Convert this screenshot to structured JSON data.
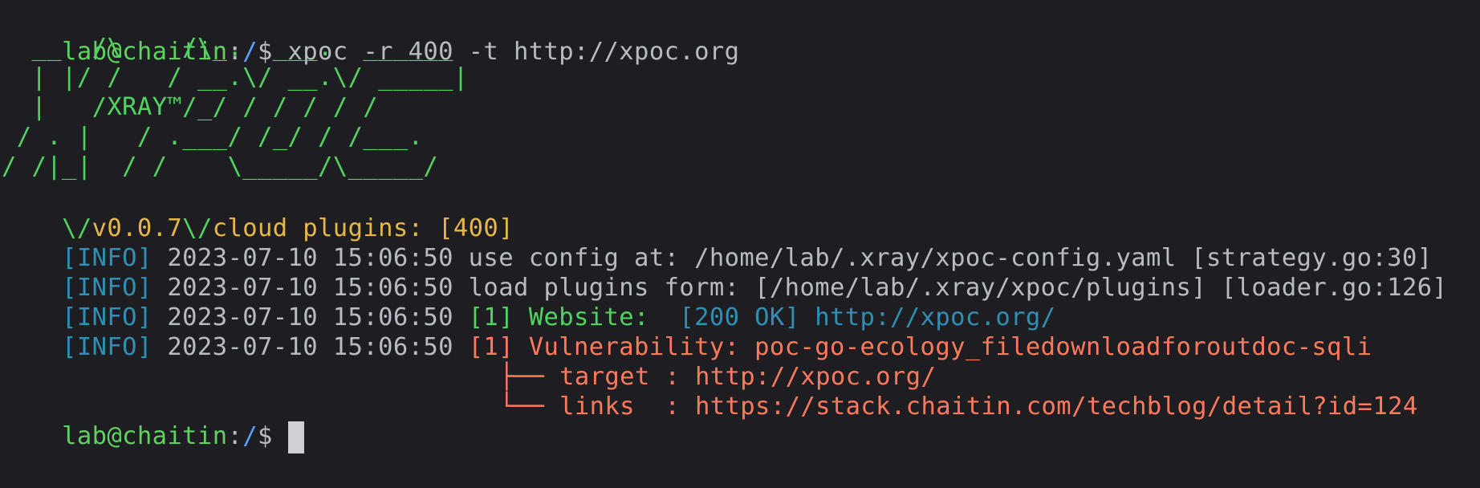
{
  "prompt": {
    "user_host": "lab@chaitin",
    "separator": ":",
    "path": "/",
    "symbol": "$ "
  },
  "command": "xpoc -r 400 -t http://xpoc.org",
  "banner": [
    "  __  /\\    /\\_.  ___.  ______",
    "  | |/ /   / __.\\/ __.\\/ _____|",
    "  |   /XRAY™/_/ / / / / /",
    " / . |   / .___/ /_/ / /___.",
    "/ /|_|  / /    \\_____/\\_____/"
  ],
  "version_line": {
    "prefix": "\\/",
    "version": "v0.0.7",
    "middle": "\\/",
    "channel": "cloud plugins: [400]"
  },
  "logs": [
    {
      "level": "[INFO]",
      "timestamp": "2023-07-10 15:06:50",
      "message": "use config at: /home/lab/.xray/xpoc-config.yaml [strategy.go:30]"
    },
    {
      "level": "[INFO]",
      "timestamp": "2023-07-10 15:06:50",
      "message": "load plugins form: [/home/lab/.xray/xpoc/plugins] [loader.go:126]"
    },
    {
      "level": "[INFO]",
      "timestamp": "2023-07-10 15:06:50",
      "tag": "[1] Website:",
      "status": "[200 OK]",
      "url": "http://xpoc.org/"
    },
    {
      "level": "[INFO]",
      "timestamp": "2023-07-10 15:06:50",
      "tag": "[1] Vulnerability:",
      "vuln": "poc-go-ecology_filedownloadforoutdoc-sqli"
    }
  ],
  "tree": [
    {
      "branch": "├── ",
      "key": "target",
      "sep": " : ",
      "value": "http://xpoc.org/"
    },
    {
      "branch": "└── ",
      "key": "links ",
      "sep": " : ",
      "value": "https://stack.chaitin.com/techblog/detail?id=124"
    }
  ],
  "colors": {
    "background": "#1e1e22",
    "prompt_green": "#5fd35f",
    "path_blue": "#5aa0ff",
    "info_cyan": "#2f8fb4",
    "version_yellow": "#e8b74a",
    "vuln_red": "#ff7a5c"
  }
}
